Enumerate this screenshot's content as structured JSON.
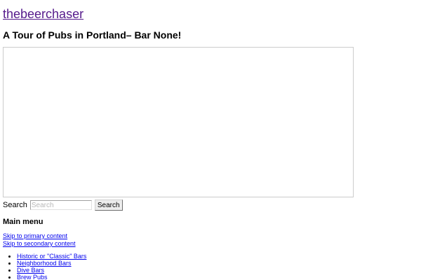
{
  "site": {
    "title": "thebeerchaser"
  },
  "post": {
    "title": "A Tour of Pubs in Portland– Bar None!"
  },
  "search": {
    "label": "Search",
    "placeholder": "Search",
    "value": "",
    "button_label": "Search"
  },
  "main_menu": {
    "heading": "Main menu",
    "skip_links": [
      {
        "label": "Skip to primary content"
      },
      {
        "label": "Skip to secondary content"
      }
    ],
    "items": [
      {
        "label": "Historic or \"Classic\" Bars"
      },
      {
        "label": "Neighborhood Bars"
      },
      {
        "label": "Dive Bars"
      },
      {
        "label": "Brew Pubs"
      }
    ]
  },
  "colors": {
    "visited_link": "#551a8b",
    "link": "#0000ee",
    "frame_border": "#cccccc"
  }
}
